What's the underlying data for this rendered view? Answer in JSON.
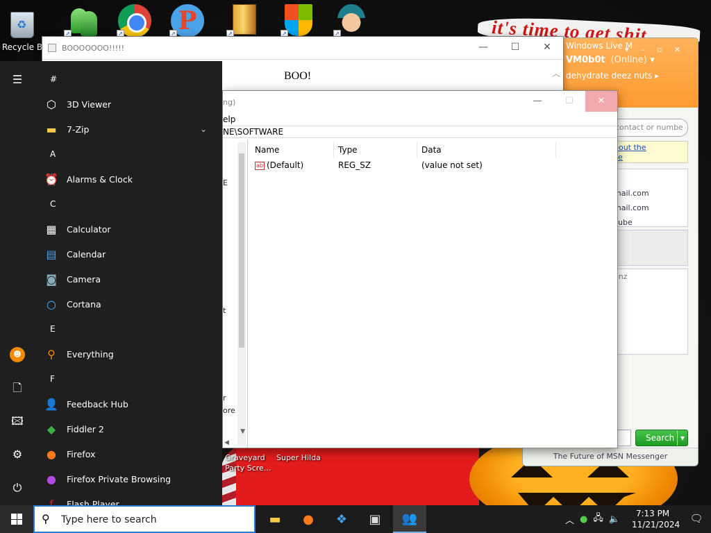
{
  "desktop": {
    "recycle_label": "Recycle B",
    "banner": "it's time to get shit",
    "shortcut_a": [
      "Graveyard",
      "Party Scre..."
    ],
    "shortcut_b": "Super Hilda"
  },
  "boo_window": {
    "title": "BOOOOOOO!!!!!",
    "text": "BOO!",
    "min": "—",
    "max": "☐",
    "close": "✕"
  },
  "regedit": {
    "title_fragment": "ng)",
    "menu_fragment": "elp",
    "address": "NE\\SOFTWARE",
    "tree_fragments": [
      "E",
      "t",
      "r",
      "ore"
    ],
    "columns": [
      "Name",
      "Type",
      "Data"
    ],
    "rows": [
      {
        "name": "(Default)",
        "type": "REG_SZ",
        "data": "(value not set)"
      }
    ]
  },
  "msn": {
    "title": "Windows Live M",
    "user": "VM0b0t",
    "status": "(Online)",
    "personal_message": "dehydrate deez nuts",
    "search_placeholder": "contact or numbe",
    "ad_line1": "bout the",
    "ad_line2": "ce",
    "contacts": [
      "mail.com",
      "mail.com",
      "cube"
    ],
    "list_fragment": "enz",
    "search_button": "Search",
    "footer": "The Future of MSN Messenger"
  },
  "start_menu": {
    "sections": [
      {
        "letter": "#",
        "apps": [
          {
            "label": "3D Viewer",
            "icon": "cube-icon"
          },
          {
            "label": "7-Zip",
            "icon": "folder-icon",
            "expandable": true
          }
        ]
      },
      {
        "letter": "A",
        "apps": [
          {
            "label": "Alarms & Clock",
            "icon": "clock-icon"
          }
        ]
      },
      {
        "letter": "C",
        "apps": [
          {
            "label": "Calculator",
            "icon": "calculator-icon"
          },
          {
            "label": "Calendar",
            "icon": "calendar-icon"
          },
          {
            "label": "Camera",
            "icon": "camera-icon"
          },
          {
            "label": "Cortana",
            "icon": "cortana-icon"
          }
        ]
      },
      {
        "letter": "E",
        "apps": [
          {
            "label": "Everything",
            "icon": "magnifier-icon"
          }
        ]
      },
      {
        "letter": "F",
        "apps": [
          {
            "label": "Feedback Hub",
            "icon": "feedback-icon"
          },
          {
            "label": "Fiddler 2",
            "icon": "fiddler-icon"
          },
          {
            "label": "Firefox",
            "icon": "firefox-icon"
          },
          {
            "label": "Firefox Private Browsing",
            "icon": "firefox-private-icon"
          },
          {
            "label": "Flash Player",
            "icon": "flash-icon"
          }
        ]
      }
    ]
  },
  "taskbar": {
    "search_placeholder": "Type here to search",
    "time": "7:13 PM",
    "date": "11/21/2024"
  }
}
